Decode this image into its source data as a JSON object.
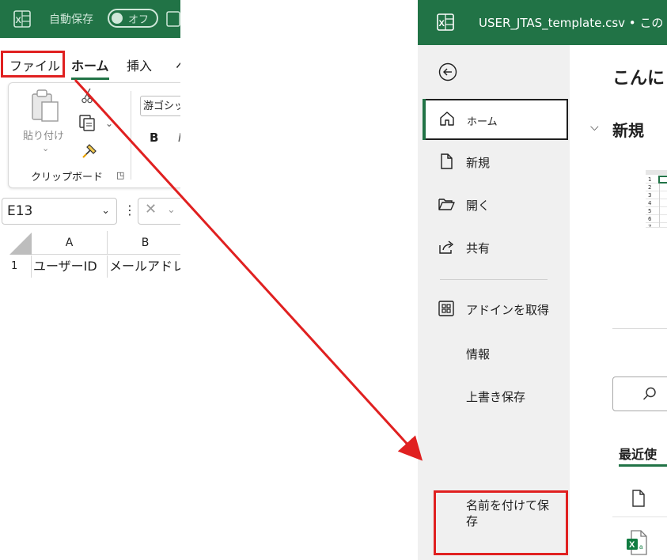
{
  "left": {
    "titlebar": {
      "autosave_label": "自動保存",
      "toggle_state": "オフ"
    },
    "menu": {
      "file_tab": "ファイル",
      "home_tab": "ホーム",
      "insert_tab": "挿入"
    },
    "ribbon": {
      "paste_label": "貼り付け",
      "clipboard_group": "クリップボード",
      "font_name": "游ゴシック",
      "bold": "B",
      "italic": "I"
    },
    "formula_bar": {
      "name_box": "E13"
    },
    "grid": {
      "columns": [
        "A",
        "B"
      ],
      "row_number": "1",
      "cells": [
        "ユーザーID",
        "メールアドレス"
      ]
    }
  },
  "right": {
    "titlebar": {
      "workbook_title": "USER_JTAS_template.csv • この"
    },
    "nav": {
      "home": "ホーム",
      "new": "新規",
      "open": "開く",
      "share": "共有",
      "addins": "アドインを取得",
      "info": "情報",
      "save": "上書き保存",
      "save_as": "名前を付けて保存"
    },
    "main": {
      "greeting": "こんに",
      "new_section": "新規",
      "thumb_rows": [
        "1",
        "2",
        "3",
        "4",
        "5",
        "6",
        "7"
      ],
      "recent_title": "最近使"
    }
  },
  "colors": {
    "excel_green": "#217346",
    "highlight_red": "#e02020",
    "nav_background": "#f0f0f0"
  },
  "icons": [
    "excel-logo-icon",
    "save-icon",
    "paste-icon",
    "cut-icon",
    "copy-icon",
    "format-painter-icon",
    "back-arrow-icon",
    "home-icon",
    "new-document-icon",
    "open-folder-icon",
    "share-icon",
    "addins-icon",
    "search-icon",
    "xlsx-file-icon"
  ]
}
